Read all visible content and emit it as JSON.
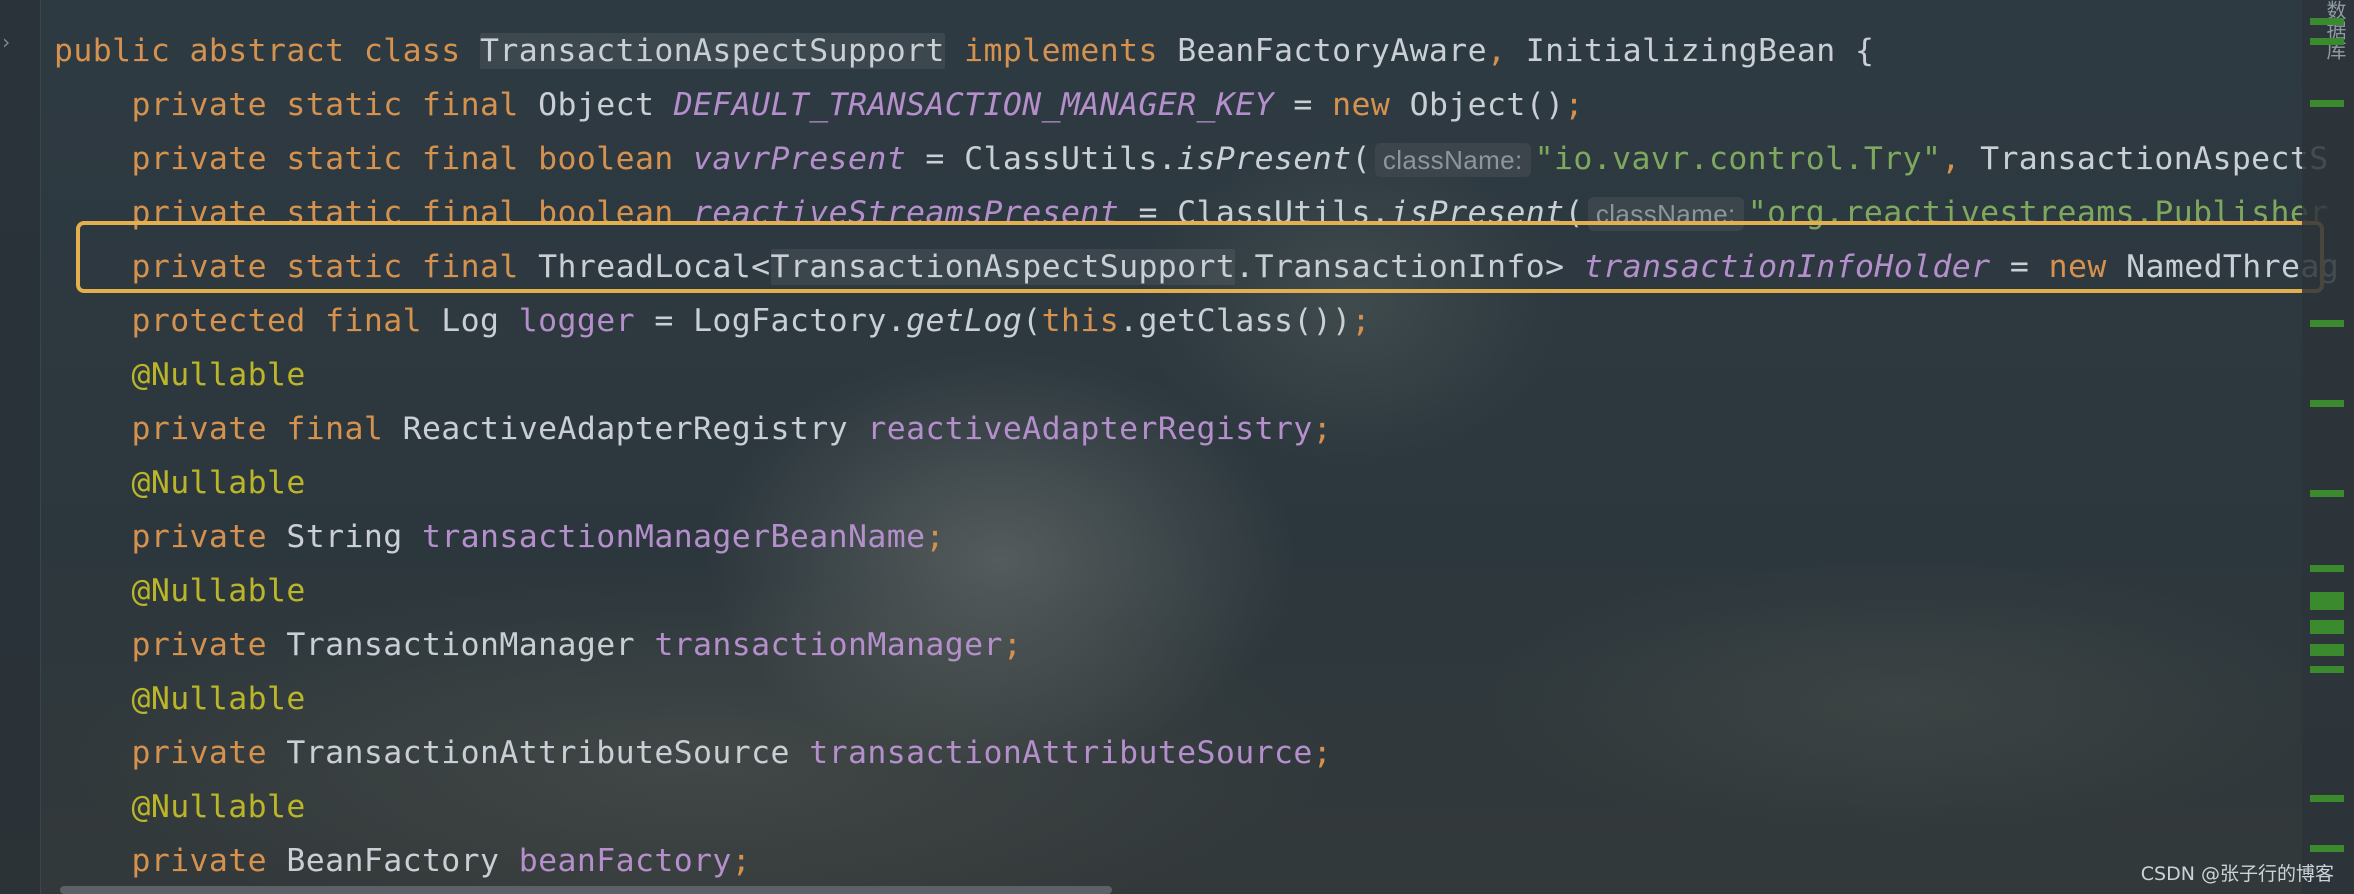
{
  "editor": {
    "lines": [
      [
        {
          "t": "public abstract class ",
          "c": "kw"
        },
        {
          "t": "TransactionAspectSupport",
          "c": "cls hl-cls"
        },
        {
          "t": " implements ",
          "c": "kw"
        },
        {
          "t": "BeanFactoryAware",
          "c": "cls"
        },
        {
          "t": ", ",
          "c": "kw"
        },
        {
          "t": "InitializingBean {",
          "c": "cls"
        }
      ],
      [
        {
          "t": "    private static final ",
          "c": "kw"
        },
        {
          "t": "Object ",
          "c": "cls"
        },
        {
          "t": "DEFAULT_TRANSACTION_MANAGER_KEY",
          "c": "sfld"
        },
        {
          "t": " = ",
          "c": "cls"
        },
        {
          "t": "new ",
          "c": "kw"
        },
        {
          "t": "Object()",
          "c": "cls"
        },
        {
          "t": ";",
          "c": "kw"
        }
      ],
      [
        {
          "t": "    private static final boolean ",
          "c": "kw"
        },
        {
          "t": "vavrPresent",
          "c": "sfld"
        },
        {
          "t": " = ClassUtils.",
          "c": "cls"
        },
        {
          "t": "isPresent",
          "c": "ital"
        },
        {
          "t": "(",
          "c": "cls"
        },
        {
          "t": "className:",
          "c": "hint"
        },
        {
          "t": "\"io.vavr.control.Try\"",
          "c": "str"
        },
        {
          "t": ", ",
          "c": "kw"
        },
        {
          "t": "TransactionAspectS",
          "c": "cls"
        }
      ],
      [
        {
          "t": "    private static final boolean ",
          "c": "kw"
        },
        {
          "t": "reactiveStreamsPresent",
          "c": "sfld"
        },
        {
          "t": " = ClassUtils.",
          "c": "cls"
        },
        {
          "t": "isPresent",
          "c": "ital"
        },
        {
          "t": "(",
          "c": "cls"
        },
        {
          "t": "className:",
          "c": "hint"
        },
        {
          "t": "\"org.reactivestreams.Publisher",
          "c": "str"
        }
      ],
      [
        {
          "t": "    private static final ",
          "c": "kw"
        },
        {
          "t": "ThreadLocal<",
          "c": "cls"
        },
        {
          "t": "TransactionAspectSupport",
          "c": "cls hl-cls"
        },
        {
          "t": ".TransactionInfo> ",
          "c": "cls"
        },
        {
          "t": "transactionInfoHolder",
          "c": "sfld"
        },
        {
          "t": " = ",
          "c": "cls"
        },
        {
          "t": "new ",
          "c": "kw"
        },
        {
          "t": "NamedThreag",
          "c": "cls"
        }
      ],
      [
        {
          "t": "    protected final ",
          "c": "kw"
        },
        {
          "t": "Log ",
          "c": "cls"
        },
        {
          "t": "logger",
          "c": "fld"
        },
        {
          "t": " = LogFactory.",
          "c": "cls"
        },
        {
          "t": "getLog",
          "c": "ital"
        },
        {
          "t": "(",
          "c": "cls"
        },
        {
          "t": "this",
          "c": "kw"
        },
        {
          "t": ".getClass())",
          "c": "cls"
        },
        {
          "t": ";",
          "c": "kw"
        }
      ],
      [
        {
          "t": "    @Nullable",
          "c": "ann"
        }
      ],
      [
        {
          "t": "    private final ",
          "c": "kw"
        },
        {
          "t": "ReactiveAdapterRegistry ",
          "c": "cls"
        },
        {
          "t": "reactiveAdapterRegistry",
          "c": "fld"
        },
        {
          "t": ";",
          "c": "kw"
        }
      ],
      [
        {
          "t": "    @Nullable",
          "c": "ann"
        }
      ],
      [
        {
          "t": "    private ",
          "c": "kw"
        },
        {
          "t": "String ",
          "c": "cls"
        },
        {
          "t": "transactionManagerBeanName",
          "c": "fld"
        },
        {
          "t": ";",
          "c": "kw"
        }
      ],
      [
        {
          "t": "    @Nullable",
          "c": "ann"
        }
      ],
      [
        {
          "t": "    private ",
          "c": "kw"
        },
        {
          "t": "TransactionManager ",
          "c": "cls"
        },
        {
          "t": "transactionManager",
          "c": "fld"
        },
        {
          "t": ";",
          "c": "kw"
        }
      ],
      [
        {
          "t": "    @Nullable",
          "c": "ann"
        }
      ],
      [
        {
          "t": "    private ",
          "c": "kw"
        },
        {
          "t": "TransactionAttributeSource ",
          "c": "cls"
        },
        {
          "t": "transactionAttributeSource",
          "c": "fld"
        },
        {
          "t": ";",
          "c": "kw"
        }
      ],
      [
        {
          "t": "    @Nullable",
          "c": "ann"
        }
      ],
      [
        {
          "t": "    private ",
          "c": "kw"
        },
        {
          "t": "BeanFactory ",
          "c": "cls"
        },
        {
          "t": "beanFactory",
          "c": "fld"
        },
        {
          "t": ";",
          "c": "kw"
        }
      ]
    ]
  },
  "right_panel_label": "数据库",
  "watermark": "CSDN @张子行的博客",
  "colors": {
    "keyword": "#d5924e",
    "field": "#b48fcb",
    "string": "#7fa85f",
    "annotation": "#bbb529",
    "highlight_box": "#e4b04f",
    "change_marker": "#3b8a2e"
  }
}
